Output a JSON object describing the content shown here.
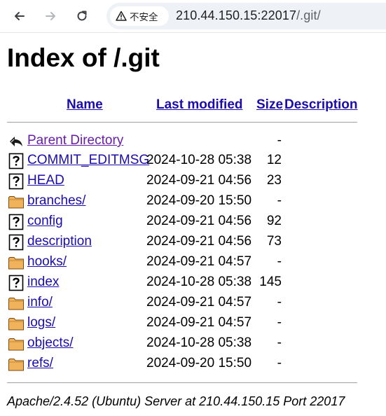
{
  "browser": {
    "security_label": "不安全",
    "url_host": "210.44.150.15:22017",
    "url_path": "/.git/"
  },
  "page": {
    "title": "Index of /.git",
    "columns": {
      "name": "Name",
      "modified": "Last modified",
      "size": "Size",
      "description": "Description"
    },
    "entries": [
      {
        "icon": "back-icon",
        "name": "Parent Directory",
        "modified": "",
        "size": "-"
      },
      {
        "icon": "unknown-file-icon",
        "name": "COMMIT_EDITMSG",
        "modified": "2024-10-28 05:38",
        "size": "12"
      },
      {
        "icon": "unknown-file-icon",
        "name": "HEAD",
        "modified": "2024-09-21 04:56",
        "size": "23"
      },
      {
        "icon": "folder-icon",
        "name": "branches/",
        "modified": "2024-09-20 15:50",
        "size": "-"
      },
      {
        "icon": "unknown-file-icon",
        "name": "config",
        "modified": "2024-09-21 04:56",
        "size": "92"
      },
      {
        "icon": "unknown-file-icon",
        "name": "description",
        "modified": "2024-09-21 04:56",
        "size": "73"
      },
      {
        "icon": "folder-icon",
        "name": "hooks/",
        "modified": "2024-09-21 04:57",
        "size": "-"
      },
      {
        "icon": "unknown-file-icon",
        "name": "index",
        "modified": "2024-10-28 05:38",
        "size": "145"
      },
      {
        "icon": "folder-icon",
        "name": "info/",
        "modified": "2024-09-21 04:57",
        "size": "-"
      },
      {
        "icon": "folder-icon",
        "name": "logs/",
        "modified": "2024-09-21 04:57",
        "size": "-"
      },
      {
        "icon": "folder-icon",
        "name": "objects/",
        "modified": "2024-10-28 05:38",
        "size": "-"
      },
      {
        "icon": "folder-icon",
        "name": "refs/",
        "modified": "2024-09-20 15:50",
        "size": "-"
      }
    ],
    "footer": "Apache/2.4.52 (Ubuntu) Server at 210.44.150.15 Port 22017"
  },
  "colors": {
    "link": "#1a0dab",
    "visited_link": "#681da8",
    "folder": "#f0b25a"
  }
}
